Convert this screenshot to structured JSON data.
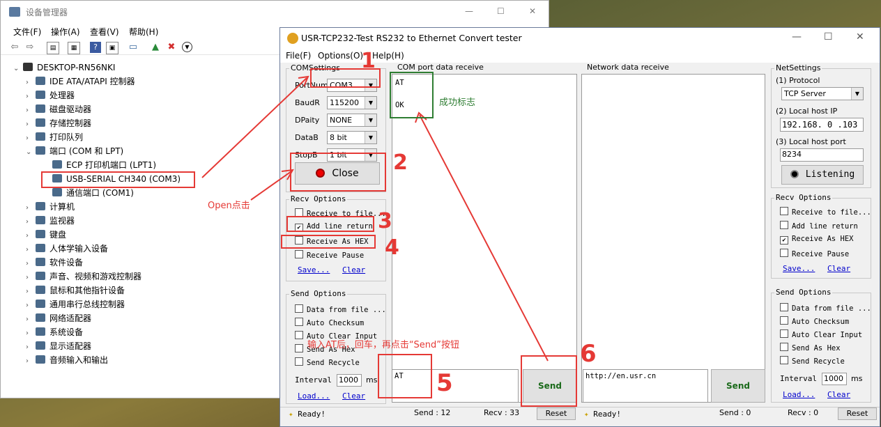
{
  "device_manager": {
    "title": "设备管理器",
    "menu": [
      "文件(F)",
      "操作(A)",
      "查看(V)",
      "帮助(H)"
    ],
    "root": "DESKTOP-RN56NKI",
    "tree": [
      {
        "label": "IDE ATA/ATAPI 控制器",
        "expanded": false
      },
      {
        "label": "处理器",
        "expanded": false
      },
      {
        "label": "磁盘驱动器",
        "expanded": false
      },
      {
        "label": "存储控制器",
        "expanded": false
      },
      {
        "label": "打印队列",
        "expanded": false
      },
      {
        "label": "端口 (COM 和 LPT)",
        "expanded": true
      },
      {
        "label": "ECP 打印机端口 (LPT1)",
        "child": true
      },
      {
        "label": "USB-SERIAL CH340 (COM3)",
        "child": true
      },
      {
        "label": "通信端口 (COM1)",
        "child": true
      },
      {
        "label": "计算机",
        "expanded": false
      },
      {
        "label": "监视器",
        "expanded": false
      },
      {
        "label": "键盘",
        "expanded": false
      },
      {
        "label": "人体学输入设备",
        "expanded": false
      },
      {
        "label": "软件设备",
        "expanded": false
      },
      {
        "label": "声音、视频和游戏控制器",
        "expanded": false
      },
      {
        "label": "鼠标和其他指针设备",
        "expanded": false
      },
      {
        "label": "通用串行总线控制器",
        "expanded": false
      },
      {
        "label": "网络适配器",
        "expanded": false
      },
      {
        "label": "系统设备",
        "expanded": false
      },
      {
        "label": "显示适配器",
        "expanded": false
      },
      {
        "label": "音频输入和输出",
        "expanded": false
      }
    ]
  },
  "tester": {
    "title": "USR-TCP232-Test  RS232 to Ethernet Convert tester",
    "menu": [
      "File(F)",
      "Options(O)",
      "Help(H)"
    ],
    "com_settings": {
      "title": "COMSettings",
      "fields": [
        {
          "label": "PortNum",
          "value": "COM3"
        },
        {
          "label": "BaudR",
          "value": "115200"
        },
        {
          "label": "DPaity",
          "value": "NONE"
        },
        {
          "label": "DataB",
          "value": "8 bit"
        },
        {
          "label": "StopB",
          "value": "1 bit"
        }
      ],
      "close_label": "Close"
    },
    "recv_left": {
      "title": "Recv Options",
      "items": [
        {
          "label": "Receive to file...",
          "checked": false
        },
        {
          "label": "Add line return",
          "checked": true
        },
        {
          "label": "Receive As HEX",
          "checked": false
        },
        {
          "label": "Receive Pause",
          "checked": false
        }
      ],
      "save": "Save...",
      "clear": "Clear"
    },
    "send_left": {
      "title": "Send Options",
      "items": [
        {
          "label": "Data from file ...",
          "checked": false
        },
        {
          "label": "Auto Checksum",
          "checked": false
        },
        {
          "label": "Auto Clear Input",
          "checked": false
        },
        {
          "label": "Send As Hex",
          "checked": false
        },
        {
          "label": "Send Recycle",
          "checked": false
        }
      ],
      "interval_label": "Interval",
      "interval_value": "1000",
      "interval_unit": "ms",
      "load": "Load...",
      "clear": "Clear"
    },
    "com_receive": {
      "title": "COM port data receive",
      "lines": [
        "AT",
        "",
        "OK"
      ]
    },
    "net_receive": {
      "title": "Network data receive",
      "lines": []
    },
    "com_send_text": "AT",
    "net_send_text": "http://en.usr.cn",
    "send_label": "Send",
    "net_settings": {
      "title": "NetSettings",
      "protocol_label": "(1) Protocol",
      "protocol": "TCP Server",
      "ip_label": "(2) Local host IP",
      "ip": "192.168. 0 .103",
      "port_label": "(3) Local host port",
      "port": "8234",
      "listen_label": "Listening"
    },
    "recv_right": {
      "title": "Recv Options",
      "items": [
        {
          "label": "Receive to file...",
          "checked": false
        },
        {
          "label": "Add line return",
          "checked": false
        },
        {
          "label": "Receive As HEX",
          "checked": true
        },
        {
          "label": "Receive Pause",
          "checked": false
        }
      ],
      "save": "Save...",
      "clear": "Clear"
    },
    "send_right": {
      "title": "Send Options",
      "items": [
        {
          "label": "Data from file ...",
          "checked": false
        },
        {
          "label": "Auto Checksum",
          "checked": false
        },
        {
          "label": "Auto Clear Input",
          "checked": false
        },
        {
          "label": "Send As Hex",
          "checked": false
        },
        {
          "label": "Send Recycle",
          "checked": false
        }
      ],
      "interval_label": "Interval",
      "interval_value": "1000",
      "interval_unit": "ms",
      "load": "Load...",
      "clear": "Clear"
    },
    "status_left": {
      "ready": "Ready!",
      "send": "Send : 12",
      "recv": "Recv : 33",
      "reset": "Reset"
    },
    "status_right": {
      "ready": "Ready!",
      "send": "Send : 0",
      "recv": "Recv : 0",
      "reset": "Reset"
    }
  },
  "annotations": {
    "n1": "1",
    "n2": "2",
    "n3": "3",
    "n4": "4",
    "n5": "5",
    "n6": "6",
    "open_click": "Open点击",
    "success": "成功标志",
    "instruction": "输入AT后，回车，再点击“Send”按钮"
  },
  "colors": {
    "annotation": "#e53935",
    "success_box": "#2e7d32",
    "link": "#0000cc"
  }
}
